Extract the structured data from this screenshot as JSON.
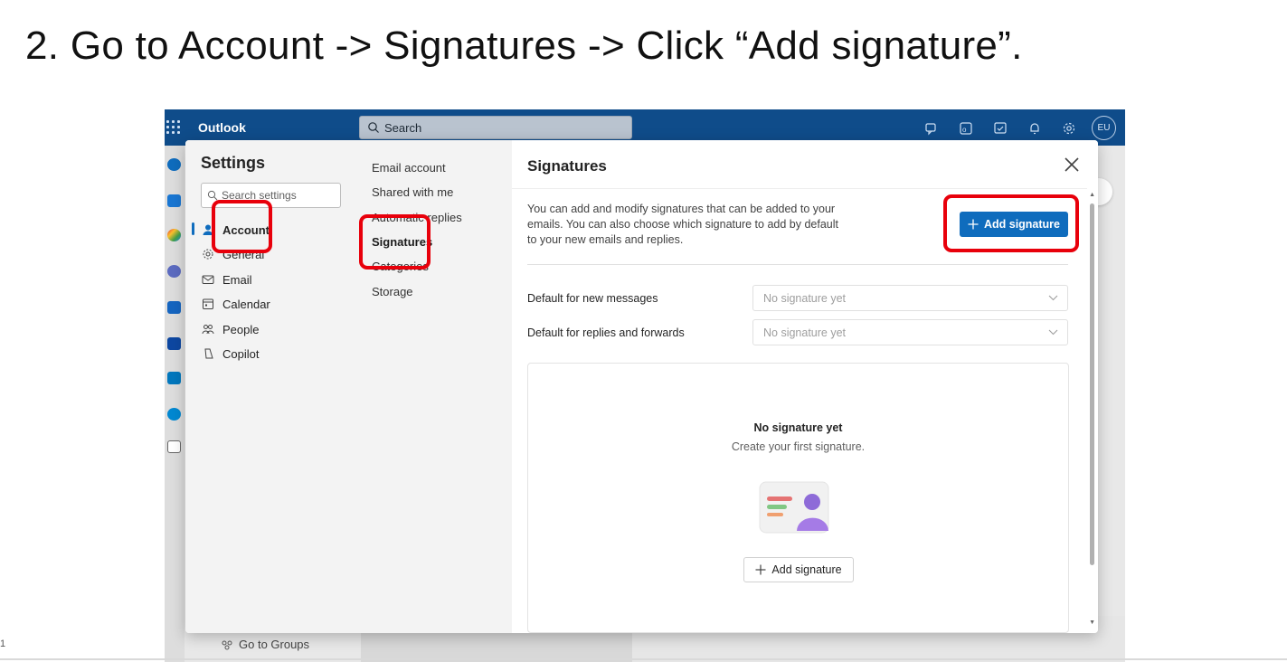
{
  "instruction": "2.  Go to Account -> Signatures -> Click “Add signature”.",
  "slide_number": "1",
  "outlook": {
    "app_name": "Outlook",
    "search_placeholder": "Search",
    "avatar_initials": "EU",
    "go_to_groups": "Go to Groups"
  },
  "settings": {
    "title": "Settings",
    "search_placeholder": "Search settings",
    "nav": [
      "Account",
      "General",
      "Email",
      "Calendar",
      "People",
      "Copilot"
    ],
    "subnav": [
      "Email account",
      "Shared with me",
      "Automatic replies",
      "Signatures",
      "Categories",
      "Storage"
    ]
  },
  "signatures": {
    "title": "Signatures",
    "description": "You can add and modify signatures that can be added to your emails. You can also choose which signature to add by default to your new emails and replies.",
    "add_button": "Add signature",
    "default_new_label": "Default for new messages",
    "default_new_value": "No signature yet",
    "default_reply_label": "Default for replies and forwards",
    "default_reply_value": "No signature yet",
    "empty_title": "No signature yet",
    "empty_subtitle": "Create your first signature.",
    "empty_add_button": "Add signature"
  },
  "colors": {
    "outlook_header": "#0f4c8a",
    "primary": "#0f6cbd",
    "highlight": "#e8000b"
  }
}
